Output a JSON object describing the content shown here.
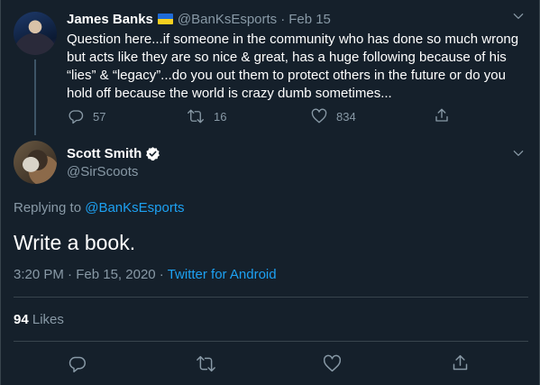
{
  "parent_tweet": {
    "author_name": "James Banks",
    "author_handle": "@BanKsEsports",
    "separator": "·",
    "date": "Feb 15",
    "text": "Question here...if someone in the community who has done so much wrong but acts like they are so nice & great, has a huge following because of his “lies” & “legacy”...do you out them to protect others in the future or do you hold off because the world is crazy dumb sometimes...",
    "replies": "57",
    "retweets": "16",
    "likes": "834"
  },
  "main_tweet": {
    "author_name": "Scott Smith",
    "author_handle": "@SirScoots",
    "replying_label": "Replying to",
    "replying_to": "@BanKsEsports",
    "text": "Write a book.",
    "time": "3:20 PM",
    "date": "Feb 15, 2020",
    "separator": "·",
    "source": "Twitter for Android",
    "likes_count": "94",
    "likes_label": "Likes"
  },
  "colors": {
    "background": "#15202b",
    "accent": "#1da1f2",
    "secondary_text": "#8899a6",
    "divider": "#38444d"
  },
  "icons": [
    "flag-icon",
    "chevron-down-icon",
    "reply-icon",
    "retweet-icon",
    "like-icon",
    "share-icon",
    "verified-icon"
  ]
}
